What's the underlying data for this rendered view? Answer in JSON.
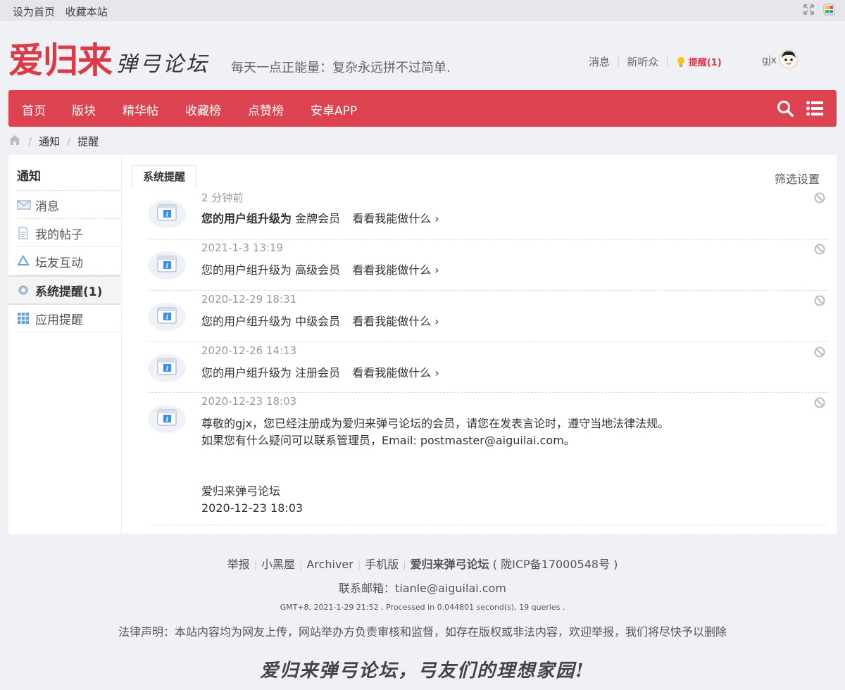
{
  "topbar": {
    "set_home": "设为首页",
    "bookmark": "收藏本站"
  },
  "header": {
    "logo_main": "爱归来",
    "logo_sub": "弹弓论坛",
    "slogan": "每天一点正能量：复杂永远拼不过简单.",
    "messages": "消息",
    "followers": "新听众",
    "remind": "提醒(1)",
    "username": "gjx"
  },
  "nav": {
    "items": [
      "首页",
      "版块",
      "精华帖",
      "收藏榜",
      "点赞榜",
      "安卓APP"
    ],
    "search_icon": "search-icon",
    "menu_icon": "list-icon"
  },
  "breadcrumb": {
    "items": [
      "通知",
      "提醒"
    ]
  },
  "sidebar": {
    "title": "通知",
    "items": [
      {
        "label": "消息",
        "icon": "envelope-icon"
      },
      {
        "label": "我的帖子",
        "icon": "document-icon"
      },
      {
        "label": "坛友互动",
        "icon": "recycle-icon"
      },
      {
        "label": "系统提醒(1)",
        "icon": "gear-icon"
      },
      {
        "label": "应用提醒",
        "icon": "grid-icon"
      }
    ]
  },
  "main": {
    "tab": "系统提醒",
    "filter": "筛选设置",
    "notices": [
      {
        "time": "2 分钟前",
        "prefix": "您的用户组升级为",
        "group": "金牌会员",
        "more": "看看我能做什么 ›"
      },
      {
        "time": "2021-1-3 13:19",
        "prefix": "您的用户组升级为",
        "group": "高级会员",
        "more": "看看我能做什么 ›"
      },
      {
        "time": "2020-12-29 18:31",
        "prefix": "您的用户组升级为",
        "group": "中级会员",
        "more": "看看我能做什么 ›"
      },
      {
        "time": "2020-12-26 14:13",
        "prefix": "您的用户组升级为",
        "group": "注册会员",
        "more": "看看我能做什么 ›"
      },
      {
        "time": "2020-12-23 18:03",
        "line1": "尊敬的gjx，您已经注册成为爱归来弹弓论坛的会员，请您在发表言论时，遵守当地法律法规。",
        "line2": "如果您有什么疑问可以联系管理员，Email: postmaster@aiguilai.com。",
        "sign": "爱归来弹弓论坛",
        "sign_date": "2020-12-23 18:03"
      }
    ]
  },
  "footer": {
    "links": [
      "举报",
      "小黑屋",
      "Archiver",
      "手机版"
    ],
    "site": "爱归来弹弓论坛",
    "icp": "( 陇ICP备17000548号 )",
    "contact": "联系邮箱：tianle@aiguilai.com",
    "stats": "GMT+8, 2021-1-29 21:52 , Processed in 0.044801 second(s), 19 queries .",
    "legal": "法律声明：本站内容均为网友上传，网站举办方负责审核和监督，如存在版权或非法内容，欢迎举报，我们将尽快予以删除",
    "motto": "爱归来弹弓论坛，弓友们的理想家园!"
  },
  "colors": {
    "brand": "#dd4250",
    "remind": "#dd3a47"
  }
}
